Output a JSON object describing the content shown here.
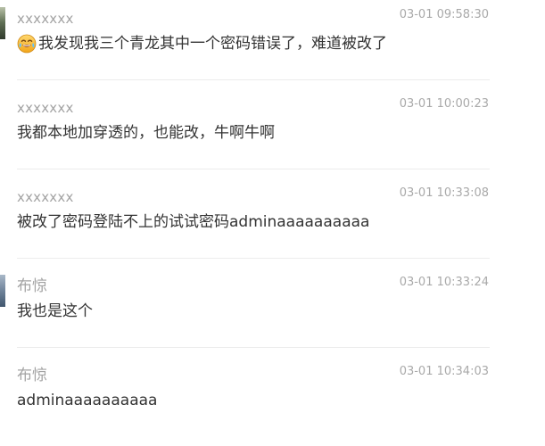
{
  "comments": [
    {
      "user": "xxxxxxx",
      "time": "03-01 09:58:30",
      "text": "我发现我三个青龙其中一个密码错误了，难道被改了",
      "icon": "crying-laughing-emoji-icon"
    },
    {
      "user": "xxxxxxx",
      "time": "03-01 10:00:23",
      "text": "我都本地加穿透的，也能改，牛啊牛啊"
    },
    {
      "user": "xxxxxxx",
      "time": "03-01 10:33:08",
      "text": "被改了密码登陆不上的试试密码adminaaaaaaaaaa"
    },
    {
      "user": "布惊",
      "time": "03-01 10:33:24",
      "text": "我也是这个"
    },
    {
      "user": "布惊",
      "time": "03-01 10:34:03",
      "text": "adminaaaaaaaaaa"
    }
  ]
}
